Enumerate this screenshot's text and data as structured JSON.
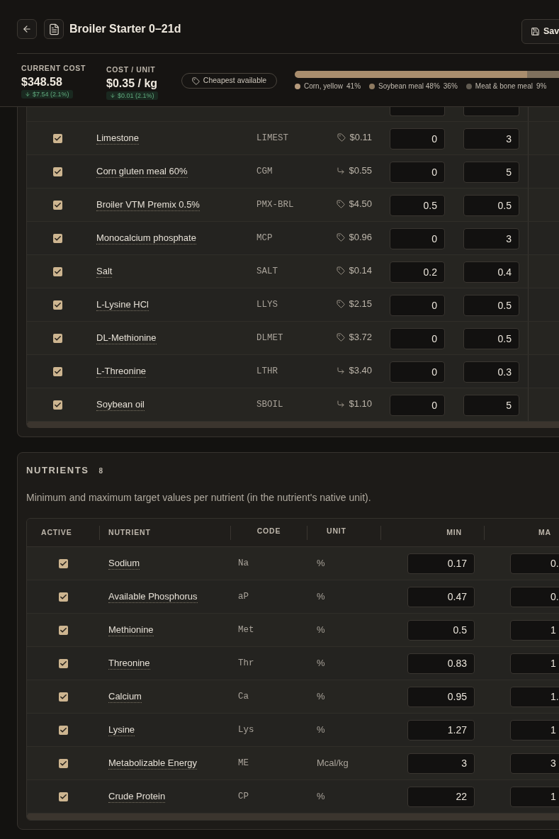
{
  "header": {
    "title": "Broiler Starter 0–21d",
    "save_label": "Sav"
  },
  "costs": [
    {
      "label": "CURRENT COST",
      "value": "$348.58",
      "change": "$7.54 (2.1%)"
    },
    {
      "label": "COST / UNIT",
      "value": "$0.35 / kg",
      "change": "$0.01 (2.1%)"
    }
  ],
  "price_mode": "Cheapest available",
  "composition_bar": [
    {
      "level": 0.88,
      "color": "#a98d6d"
    },
    {
      "level": 0.12,
      "color": "#7f705d"
    }
  ],
  "composition": [
    {
      "name": "Corn, yellow",
      "share": "41%",
      "color": "#b59a7c"
    },
    {
      "name": "Soybean meal 48%",
      "share": "36%",
      "color": "#8e7a60"
    },
    {
      "name": "Meat & bone meal",
      "share": "9%",
      "color": "#615b51"
    }
  ],
  "ingredients": {
    "rows": [
      {
        "active": true,
        "name": "Limestone",
        "code": "LIMEST",
        "kind": "tag",
        "price": "$0.11",
        "min": "0",
        "max": "3"
      },
      {
        "active": true,
        "name": "Corn gluten meal 60%",
        "code": "CGM",
        "kind": "link",
        "price": "$0.55",
        "min": "0",
        "max": "5"
      },
      {
        "active": true,
        "name": "Broiler VTM Premix 0.5%",
        "code": "PMX-BRL",
        "kind": "tag",
        "price": "$4.50",
        "min": "0.5",
        "max": "0.5"
      },
      {
        "active": true,
        "name": "Monocalcium phosphate",
        "code": "MCP",
        "kind": "tag",
        "price": "$0.96",
        "min": "0",
        "max": "3"
      },
      {
        "active": true,
        "name": "Salt",
        "code": "SALT",
        "kind": "tag",
        "price": "$0.14",
        "min": "0.2",
        "max": "0.4"
      },
      {
        "active": true,
        "name": "L-Lysine HCl",
        "code": "LLYS",
        "kind": "tag",
        "price": "$2.15",
        "min": "0",
        "max": "0.5"
      },
      {
        "active": true,
        "name": "DL-Methionine",
        "code": "DLMET",
        "kind": "tag",
        "price": "$3.72",
        "min": "0",
        "max": "0.5"
      },
      {
        "active": true,
        "name": "L-Threonine",
        "code": "LTHR",
        "kind": "link",
        "price": "$3.40",
        "min": "0",
        "max": "0.3"
      },
      {
        "active": true,
        "name": "Soybean oil",
        "code": "SBOIL",
        "kind": "link",
        "price": "$1.10",
        "min": "0",
        "max": "5"
      }
    ]
  },
  "nutrients": {
    "title": "NUTRIENTS",
    "count": "8",
    "description": "Minimum and maximum target values per nutrient (in the nutrient's native unit).",
    "columns": [
      "ACTIVE",
      "NUTRIENT",
      "CODE",
      "UNIT",
      "MIN",
      "MA"
    ],
    "rows": [
      {
        "active": true,
        "name": "Sodium",
        "code": "Na",
        "unit": "%",
        "min": "0.17",
        "max": "0."
      },
      {
        "active": true,
        "name": "Available Phosphorus",
        "code": "aP",
        "unit": "%",
        "min": "0.47",
        "max": "0."
      },
      {
        "active": true,
        "name": "Methionine",
        "code": "Met",
        "unit": "%",
        "min": "0.5",
        "max": "1"
      },
      {
        "active": true,
        "name": "Threonine",
        "code": "Thr",
        "unit": "%",
        "min": "0.83",
        "max": "1"
      },
      {
        "active": true,
        "name": "Calcium",
        "code": "Ca",
        "unit": "%",
        "min": "0.95",
        "max": "1."
      },
      {
        "active": true,
        "name": "Lysine",
        "code": "Lys",
        "unit": "%",
        "min": "1.27",
        "max": "1"
      },
      {
        "active": true,
        "name": "Metabolizable Energy",
        "code": "ME",
        "unit": "Mcal/kg",
        "min": "3",
        "max": "3"
      },
      {
        "active": true,
        "name": "Crude Protein",
        "code": "CP",
        "unit": "%",
        "min": "22",
        "max": "1"
      }
    ]
  }
}
